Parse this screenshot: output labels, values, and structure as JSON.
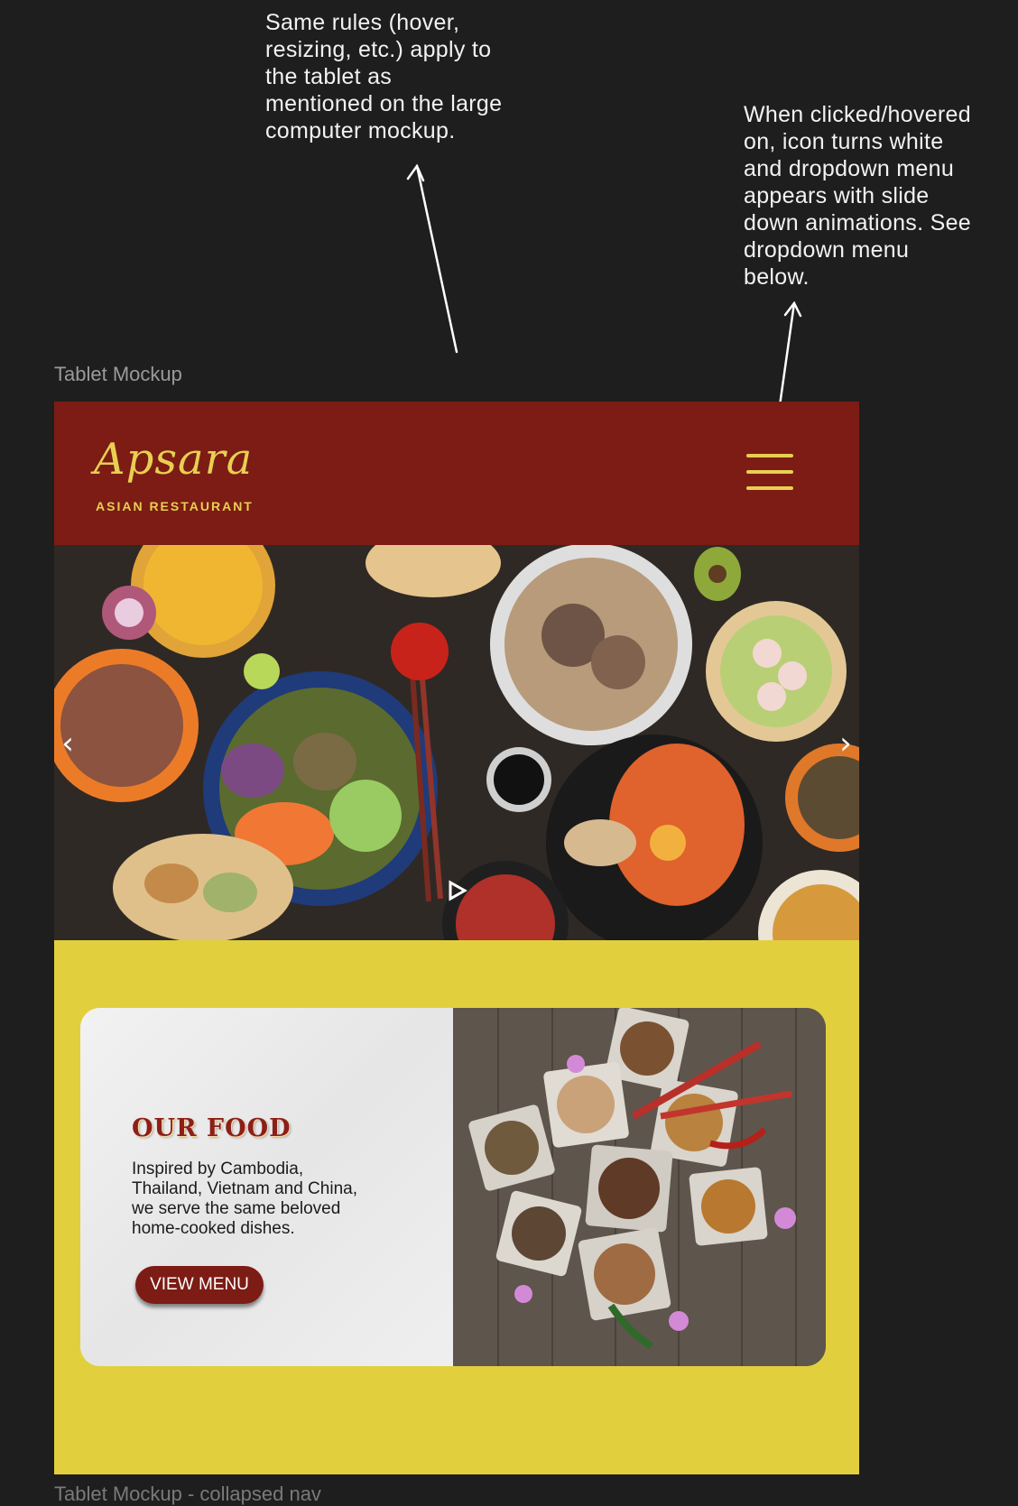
{
  "annotations": {
    "left_note": "Same rules (hover,\nresizing, etc.) apply to\nthe tablet as\nmentioned on the large\ncomputer mockup.",
    "right_note": "When clicked/hovered\non, icon turns white\nand dropdown menu\nappears with slide\ndown animations. See\ndropdown menu\nbelow."
  },
  "frame": {
    "label": "Tablet Mockup",
    "next_label": "Tablet Mockup - collapsed nav"
  },
  "header": {
    "logo_script": "Apsara",
    "logo_subtitle": "ASIAN RESTAURANT",
    "menu_icon": "hamburger-icon"
  },
  "hero": {
    "prev_icon": "chevron-left-icon",
    "next_icon": "chevron-right-icon",
    "play_icon": "play-icon"
  },
  "food_section": {
    "title": "OUR FOOD",
    "description": "Inspired by Cambodia,\nThailand, Vietnam and China,\nwe serve the same beloved\nhome-cooked dishes.",
    "button_label": "VIEW MENU"
  },
  "colors": {
    "page_background": "#1e1e1e",
    "header_red": "#7c1c14",
    "accent_yellow": "#e2cf3e",
    "logo_gold": "#e8cf52",
    "button_red": "#7c1c14"
  }
}
